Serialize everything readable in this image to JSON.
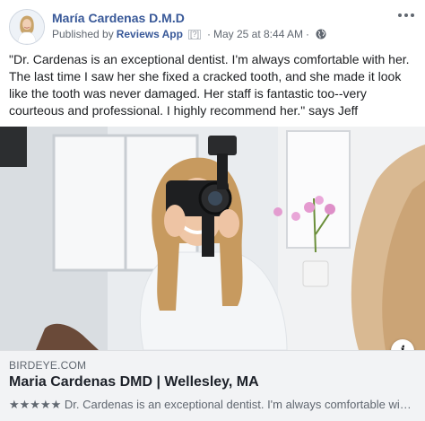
{
  "post": {
    "page_name": "María Cardenas D.M.D",
    "published_by_prefix": "Published by",
    "app_name": "Reviews App",
    "help_marker": "[?]",
    "separator": "·",
    "date": "May 25 at 8:44 AM",
    "privacy_icon": "globe-icon",
    "more_icon": "more-options-icon",
    "text": "\"Dr. Cardenas is an exceptional dentist. I'm always comfortable with her. The last time I saw her she fixed a cracked tooth, and she made it look like the tooth was never damaged. Her staff is fantastic too--very courteous and professional. I highly recommend her.\" says Jeff"
  },
  "link_preview": {
    "domain": "BIRDEYE.COM",
    "title": "Maria Cardenas DMD | Wellesley, MA",
    "description": "★★★★★ Dr. Cardenas is an exceptional dentist. I'm always comfortable with her. The last time I saw her she fixed a cracked tooth",
    "info_label": "i"
  },
  "colors": {
    "link_blue": "#385898",
    "meta_gray": "#606770",
    "preview_bg": "#f2f3f5"
  }
}
